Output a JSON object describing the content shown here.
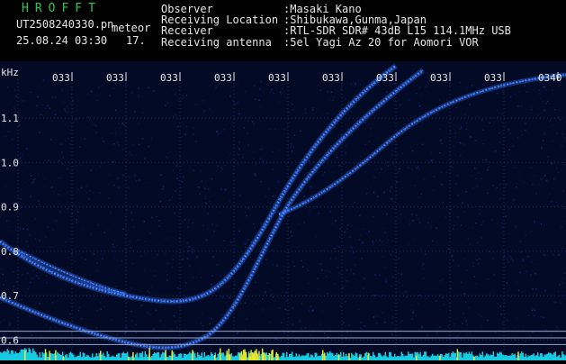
{
  "header": {
    "logo": "HROFFT",
    "filename": "UT2508240330.pn",
    "tag": "meteor",
    "datetime": "25.08.24 03:30",
    "minute": "17.",
    "info_rows": [
      {
        "key": "Observer",
        "value": ":Masaki Kano"
      },
      {
        "key": "Receiving Location",
        "value": ":Shibukawa,Gunma,Japan"
      },
      {
        "key": "Receiver",
        "value": ":RTL-SDR SDR# 43dB L15 114.1MHz USB"
      },
      {
        "key": "Receiving antenna",
        "value": ":5el Yagi Az 20 for Aomori VOR"
      }
    ]
  },
  "chart_data": {
    "type": "heatmap",
    "ylabel": "kHz",
    "ylim": [
      0.58,
      1.2
    ],
    "y_ticks": [
      {
        "value": 1.1,
        "label": "1.1"
      },
      {
        "value": 1.0,
        "label": "1.0"
      },
      {
        "value": 0.9,
        "label": "0.9"
      },
      {
        "value": 0.8,
        "label": "0.8"
      },
      {
        "value": 0.7,
        "label": "0.7"
      },
      {
        "value": 0.6,
        "label": "0.6"
      }
    ],
    "x_ticks": [
      "033",
      "033",
      "033",
      "033",
      "033",
      "033",
      "033",
      "033",
      "033",
      "0340"
    ],
    "hlines": [
      0.62,
      0.605,
      0.59
    ],
    "colors": {
      "background": "#030a26",
      "grid": "#1a2c5a",
      "signal": "#3a78ff",
      "signal_hot": "#c8e4ff",
      "labels": "#e8e8e8",
      "noise": "#17c9e0",
      "hot": "#e8e830"
    }
  }
}
